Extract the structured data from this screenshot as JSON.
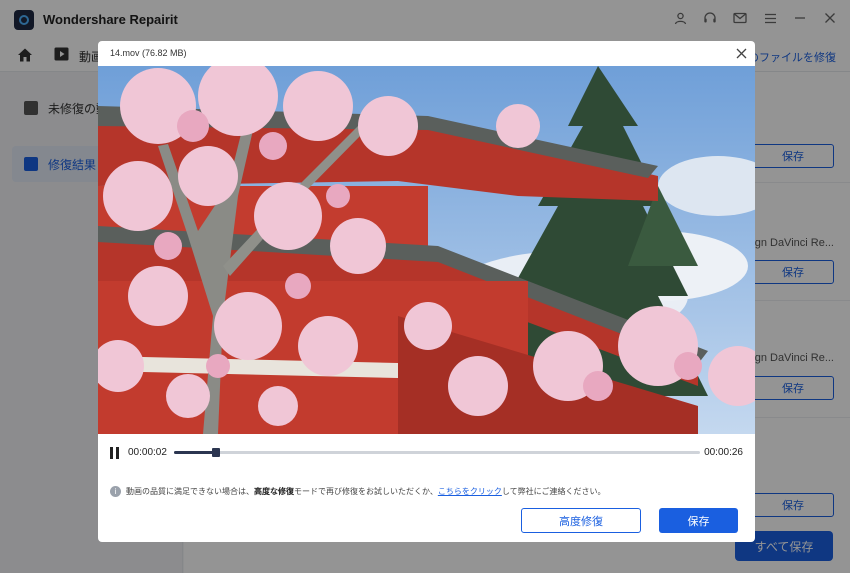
{
  "app": {
    "title": "Wondershare Repairit",
    "icons": [
      "user-icon",
      "headset-icon",
      "mail-icon",
      "menu-icon",
      "minimize-icon",
      "close-icon"
    ]
  },
  "toolbar": {
    "tab_label": "動画",
    "right_text": "類のファイルを修復"
  },
  "sidebar": {
    "items": [
      {
        "label": "未修復の動",
        "icon": "video-icon",
        "active": false
      },
      {
        "label": "修復結果 (",
        "icon": "file-icon",
        "active": true
      }
    ]
  },
  "main": {
    "rows": [
      {
        "desc": "",
        "save_label": "保存"
      },
      {
        "desc": "esign DaVinci Re...",
        "save_label": "保存"
      },
      {
        "desc": "esign DaVinci Re...",
        "save_label": "保存"
      },
      {
        "desc": "",
        "save_label": "保存"
      }
    ],
    "save_all_label": "すべて保存"
  },
  "modal": {
    "file_title": "14.mov (76.82  MB)",
    "video_description": "",
    "time_current": "00:00:02",
    "time_total": "00:00:26",
    "progress": 0.08,
    "notice": {
      "part1": "動画の品質に満足できない場合は、",
      "bold": "高度な修復",
      "part2": "モードで再び修復をお試しいただくか、",
      "link": "こちらをクリック",
      "part3": "して弊社にご連絡ください。"
    },
    "advanced_button": "高度修復",
    "save_button": "保存"
  },
  "colors": {
    "accent": "#1a5fe0",
    "overlay": "rgba(0,0,0,0.42)"
  }
}
